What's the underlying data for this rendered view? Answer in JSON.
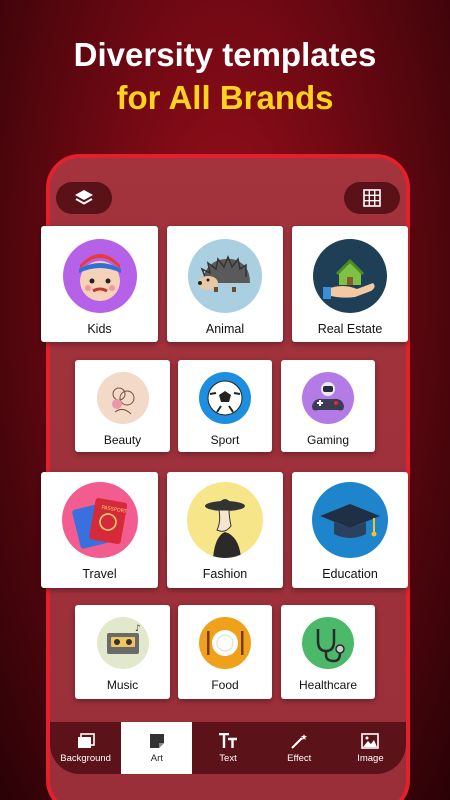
{
  "headline": {
    "line1": "Diversity templates",
    "line2": "for All Brands"
  },
  "colors": {
    "accent_yellow": "#ffd21f",
    "phone_border": "#e3202c",
    "toolbar_bg": "#5b1219"
  },
  "top_controls": {
    "left_icon": "layers-icon",
    "right_icon": "grid-icon"
  },
  "categories": [
    {
      "label": "Kids",
      "icon": "kid-face-icon"
    },
    {
      "label": "Animal",
      "icon": "hedgehog-icon"
    },
    {
      "label": "Real Estate",
      "icon": "house-in-hand-icon"
    },
    {
      "label": "Beauty",
      "icon": "flower-icon"
    },
    {
      "label": "Sport",
      "icon": "soccer-ball-icon"
    },
    {
      "label": "Gaming",
      "icon": "astronaut-gamepad-icon"
    },
    {
      "label": "Travel",
      "icon": "passport-icon"
    },
    {
      "label": "Fashion",
      "icon": "woman-hat-icon"
    },
    {
      "label": "Education",
      "icon": "graduation-cap-icon"
    },
    {
      "label": "Music",
      "icon": "cassette-icon"
    },
    {
      "label": "Food",
      "icon": "plate-icon"
    },
    {
      "label": "Healthcare",
      "icon": "stethoscope-icon"
    }
  ],
  "toolbar": {
    "items": [
      {
        "label": "Background",
        "icon": "background-icon"
      },
      {
        "label": "Art",
        "icon": "sticker-icon",
        "active": true
      },
      {
        "label": "Text",
        "icon": "text-icon"
      },
      {
        "label": "Effect",
        "icon": "magic-wand-icon"
      },
      {
        "label": "Image",
        "icon": "image-icon"
      }
    ]
  }
}
